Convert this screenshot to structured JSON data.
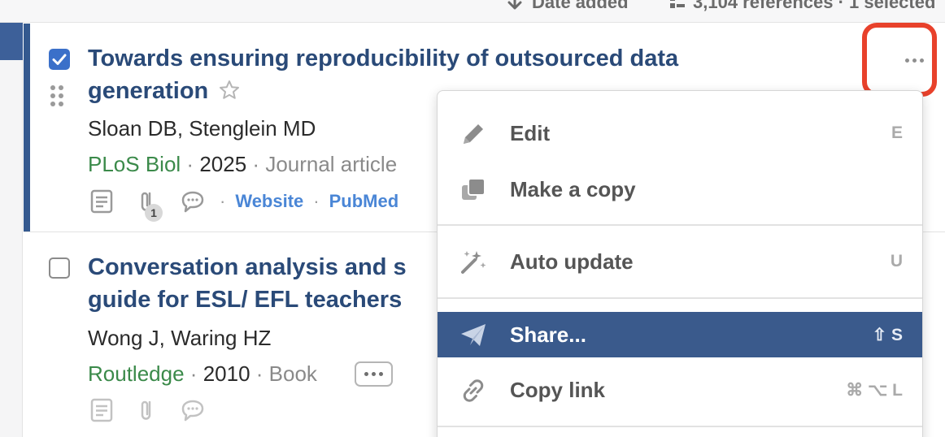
{
  "toolbar": {
    "sort_label": "Date added",
    "references_label": "3,104 references · 1 selected"
  },
  "references": [
    {
      "title": "Towards ensuring reproducibility of outsourced data generation",
      "authors": "Sloan DB, Stenglein MD",
      "journal": "PLoS Biol",
      "year": "2025",
      "type": "Journal article",
      "attachment_count": "1",
      "links": [
        "Website",
        "PubMed"
      ],
      "checked": true
    },
    {
      "title_line1": "Conversation analysis and s",
      "title_line2": "guide for ESL/ EFL teachers",
      "authors": "Wong J, Waring HZ",
      "journal": "Routledge",
      "year": "2010",
      "type": "Book",
      "checked": false
    }
  ],
  "context_menu": {
    "items": [
      {
        "label": "Edit",
        "shortcut": "E",
        "icon": "pencil-icon"
      },
      {
        "label": "Make a copy",
        "shortcut": "",
        "icon": "copy-icon"
      },
      {
        "label": "Auto update",
        "shortcut": "U",
        "icon": "magic-wand-icon"
      },
      {
        "label": "Share...",
        "shortcut": "⇧ S",
        "icon": "paper-plane-icon",
        "active": true
      },
      {
        "label": "Copy link",
        "shortcut": "⌘ ⌥ L",
        "icon": "link-icon"
      }
    ]
  },
  "colors": {
    "title": "#2a4a78",
    "journal": "#3b8a4a",
    "link": "#4a86d6",
    "selection": "#34598f",
    "menu_active": "#3a5a8c",
    "highlight": "#e8412b"
  }
}
